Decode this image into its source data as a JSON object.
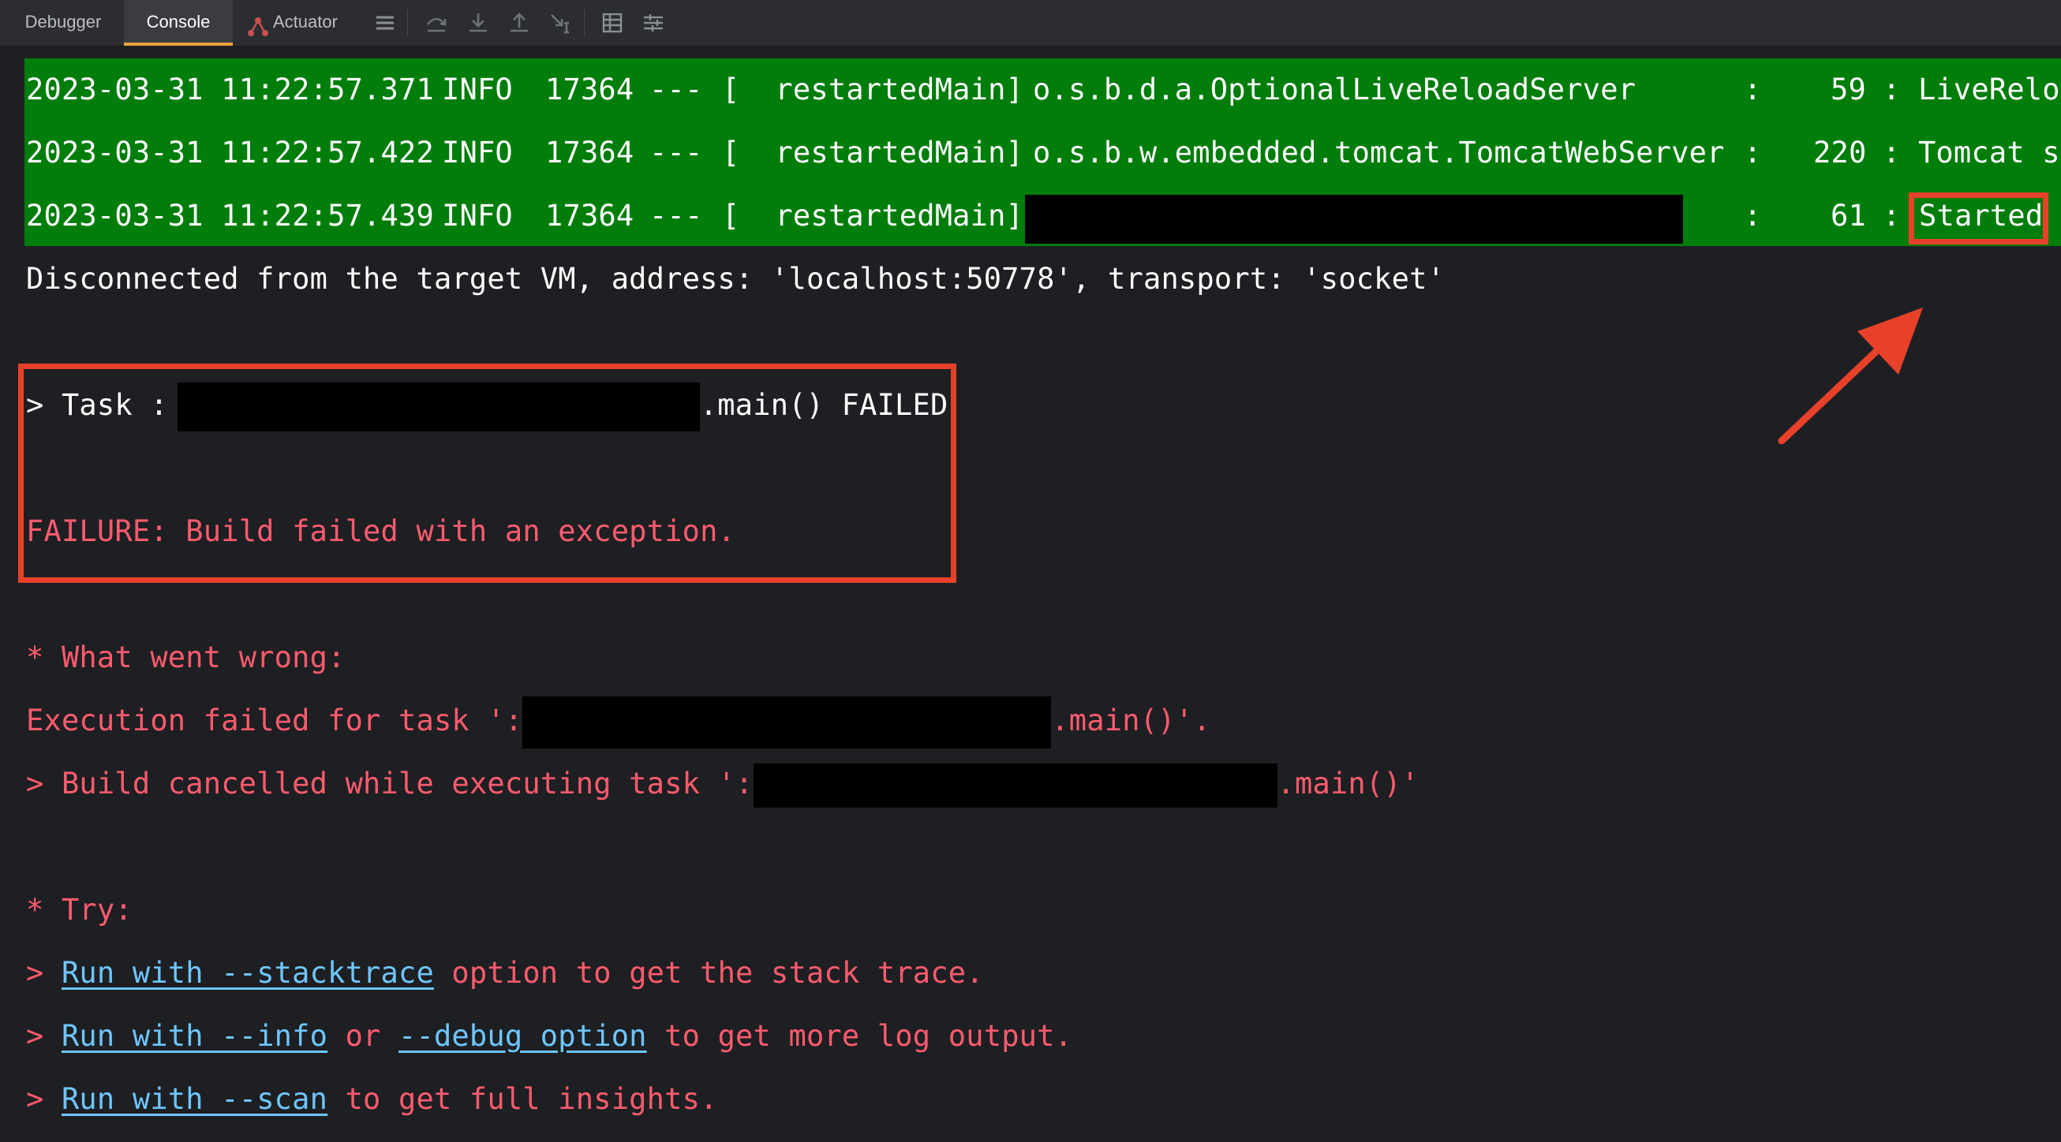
{
  "toolbar": {
    "tabs": [
      {
        "label": "Debugger",
        "active": false
      },
      {
        "label": "Console",
        "active": true
      },
      {
        "label": "Actuator",
        "active": false
      }
    ],
    "tools": [
      "menu-icon",
      "step-over-icon",
      "step-into-icon",
      "step-out-icon",
      "run-to-cursor-icon",
      "evaluate-table-icon",
      "trace-settings-icon"
    ]
  },
  "console": {
    "log_lines": [
      {
        "timestamp": "2023-03-31 11:22:57.371",
        "level": "INFO",
        "pid": "17364",
        "sep": "---",
        "thread": "[  restartedMain]",
        "logger": "o.s.b.d.a.OptionalLiveReloadServer",
        "colon": ":",
        "line": "59",
        "message": ": LiveReloa"
      },
      {
        "timestamp": "2023-03-31 11:22:57.422",
        "level": "INFO",
        "pid": "17364",
        "sep": "---",
        "thread": "[  restartedMain]",
        "logger": "o.s.b.w.embedded.tomcat.TomcatWebServer",
        "colon": ":",
        "line": "220",
        "message": ": Tomcat st"
      },
      {
        "timestamp": "2023-03-31 11:22:57.439",
        "level": "INFO",
        "pid": "17364",
        "sep": "---",
        "thread": "[  restartedMain]",
        "logger": "",
        "colon": ":",
        "line": "61",
        "message_prefix": ":",
        "message": "Started"
      }
    ],
    "disconnected": "Disconnected from the target VM, address: 'localhost:50778', transport: 'socket'",
    "task_prefix": "> Task :",
    "task_suffix": ".main() FAILED",
    "failure": "FAILURE: Build failed with an exception.",
    "what_went_wrong": "* What went wrong:",
    "exec_failed_prefix": "Execution failed for task ':",
    "exec_failed_suffix": ".main()'.",
    "build_cancelled_prefix": "> Build cancelled while executing task ':",
    "build_cancelled_suffix": ".main()'",
    "try": "* Try:",
    "hint1": {
      "prefix": "> ",
      "link": "Run with --stacktrace",
      "suffix": " option to get the stack trace."
    },
    "hint2": {
      "prefix": "> ",
      "link1": "Run with --info",
      "middle": " or ",
      "link2": "--debug option",
      "suffix": " to get more log output."
    },
    "hint3": {
      "prefix": "> ",
      "link": "Run with --scan",
      "suffix": " to get full insights."
    }
  },
  "colors": {
    "background": "#1e1f22",
    "log_highlight": "#007d0b",
    "error_text": "#ff5b6e",
    "link": "#6ec6ff",
    "annotation": "#e8412a",
    "active_tab_underline": "#e8a33a"
  }
}
